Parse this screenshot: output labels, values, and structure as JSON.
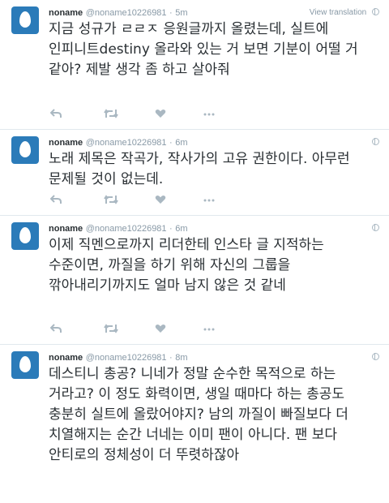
{
  "tweets": [
    {
      "fullname": "noname",
      "username": "@noname10226981",
      "dot": "·",
      "time": "5m",
      "translate_label": "View translation",
      "text": "지금 성규가 ㄹㄹㅈ 응원글까지 올렸는데, 실트에 인피니트destiny 올라와 있는 거 보면 기분이 어떨 거 같아? 제발 생각 좀 하고 살아줘"
    },
    {
      "fullname": "noname",
      "username": "@noname10226981",
      "dot": "·",
      "time": "6m",
      "translate_label": "",
      "text": "노래 제목은 작곡가, 작사가의 고유 권한이다. 아무런 문제될 것이 없는데."
    },
    {
      "fullname": "noname",
      "username": "@noname10226981",
      "dot": "·",
      "time": "6m",
      "translate_label": "",
      "text": "이제 직멘으로까지 리더한테 인스타 글 지적하는 수준이면, 까질을 하기 위해 자신의 그룹을 깎아내리기까지도 얼마 남지 않은 것 같네"
    },
    {
      "fullname": "noname",
      "username": "@noname10226981",
      "dot": "·",
      "time": "8m",
      "translate_label": "",
      "text": "데스티니 총공? 니네가 정말 순수한 목적으로 하는 거라고? 이 정도 화력이면, 생일 때마다 하는 총공도 충분히 실트에 올랐어야지? 남의 까질이 빠질보다 더 치열해지는 순간 너네는 이미 팬이 아니다. 팬 보다 안티로의 정체성이 더 뚜렷하잖아"
    }
  ],
  "colors": {
    "avatar_bg": "#2b7bb9",
    "text": "#292f33",
    "meta": "#8899a6",
    "icon": "#aab8c2",
    "divider": "#e1e8ed"
  }
}
